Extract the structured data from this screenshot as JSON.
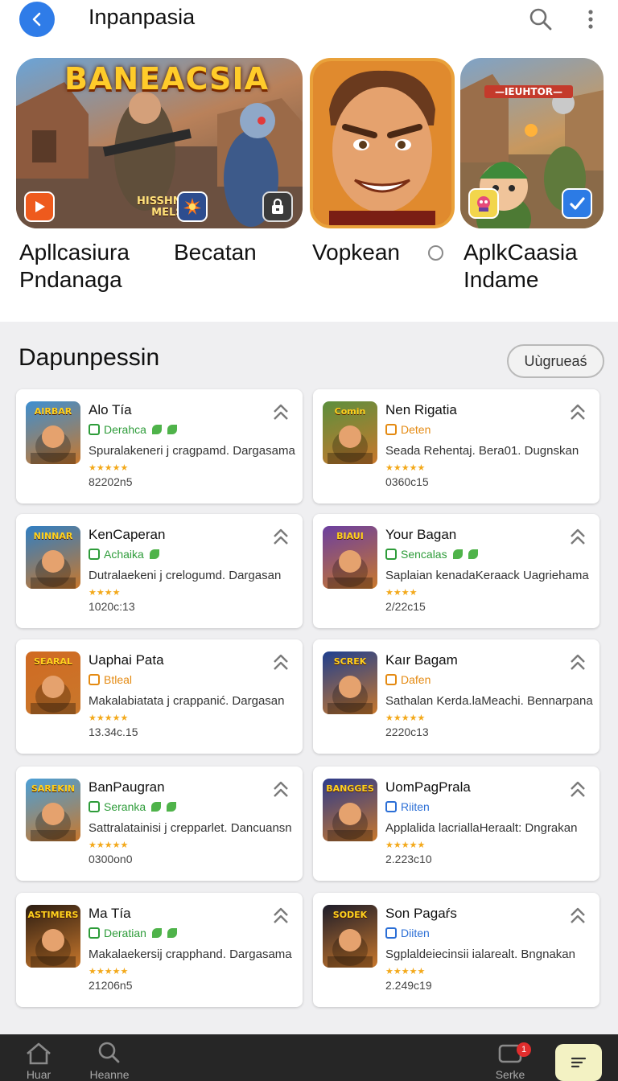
{
  "header": {
    "title": "Inpanpasia"
  },
  "featured": {
    "banner_text": "BANEACSIA",
    "banner_small_text": "HISSHNAAN\nMELSH",
    "card3_label": "—IEUHTOR—",
    "labels": [
      {
        "line1": "Apllcasiura",
        "line2": "Pndanaga"
      },
      {
        "line1": "Becatan",
        "line2": ""
      },
      {
        "line1": "Vopkean",
        "line2": ""
      },
      {
        "line1": "AplkCaasia",
        "line2": "Indame"
      }
    ]
  },
  "section": {
    "title": "Dapunpessin",
    "upgrade_label": "Uùgrueaś"
  },
  "apps": [
    {
      "name": "Alo Tía",
      "category": "Derahca",
      "cat_color": "#2e9c3a",
      "leaves": 2,
      "desc": "Spuralakeneri j cragpamd. Dargasama",
      "stars": "★★★★★",
      "meta": "82202n5",
      "icon_label": "AIRBAR",
      "icon_bg": "#3d8fd1"
    },
    {
      "name": "Nen Rigatia",
      "category": "Deten",
      "cat_color": "#e48a12",
      "leaves": 0,
      "desc": "Seada Rehentaj. Bera01. Dugnskan",
      "stars": "★★★★★",
      "meta": "0360c15",
      "icon_label": "Comin",
      "icon_bg": "#5c8f3d"
    },
    {
      "name": "KenCaperan",
      "category": "Achaika",
      "cat_color": "#2e9c3a",
      "leaves": 1,
      "desc": "Dutralaekeni j crelogumd. Dargasan",
      "stars": "★★★★",
      "meta": "1020c:13",
      "icon_label": "NINNAR",
      "icon_bg": "#2f7fc4"
    },
    {
      "name": "Your Bagan",
      "category": "Sencalas",
      "cat_color": "#2e9c3a",
      "leaves": 2,
      "desc": "Saplaian kenadaKeraack Uagriehama",
      "stars": "★★★★",
      "meta": "2/22c15",
      "icon_label": "BIAUI",
      "icon_bg": "#6b3fa0"
    },
    {
      "name": "Uaphai Pata",
      "category": "Btleal",
      "cat_color": "#e48a12",
      "leaves": 0,
      "desc": "Makalabiatata j crappanić. Dargasan",
      "stars": "★★★★★",
      "meta": "13.34c.15",
      "icon_label": "SEARAL",
      "icon_bg": "#d06a22"
    },
    {
      "name": "Kaır Bagam",
      "category": "Dafen",
      "cat_color": "#e48a12",
      "leaves": 0,
      "desc": "Sathalan Kerda.laMeachi. Bennarpana",
      "stars": "★★★★★",
      "meta": "2220c13",
      "icon_label": "SCREK",
      "icon_bg": "#1f3f8f"
    },
    {
      "name": "BanPaugran",
      "category": "Seranka",
      "cat_color": "#2e9c3a",
      "leaves": 2,
      "desc": "Sattralatainisi j crepparlet. Dancuansn",
      "stars": "★★★★★",
      "meta": "0300on0",
      "icon_label": "SAREKIN",
      "icon_bg": "#4aa0d8"
    },
    {
      "name": "UomPagPrala",
      "category": "Riiten",
      "cat_color": "#2c6fd6",
      "leaves": 0,
      "desc": "Applalida lacriallaHeraalt: Dngrakan",
      "stars": "★★★★★",
      "meta": "2.223c10",
      "icon_label": "BANGGES",
      "icon_bg": "#2b3a8c"
    },
    {
      "name": "Ma Tía",
      "category": "Deratian",
      "cat_color": "#2e9c3a",
      "leaves": 2,
      "desc": "Makalaekersij crapphand. Dargasama",
      "stars": "★★★★★",
      "meta": "21206n5",
      "icon_label": "ASTIMERS",
      "icon_bg": "#2a1c12"
    },
    {
      "name": "Son Pagaŕs",
      "category": "Diiten",
      "cat_color": "#2c6fd6",
      "leaves": 0,
      "desc": "Sgplaldeiecinsii ialarealt. Bngnakan",
      "stars": "★★★★★",
      "meta": "2.249c19",
      "icon_label": "SODEK",
      "icon_bg": "#1c1c2a"
    }
  ],
  "bottom_nav": {
    "home_label": "Huar",
    "search_label": "Heanne",
    "inbox_label": "Serke",
    "inbox_badge": "1"
  }
}
